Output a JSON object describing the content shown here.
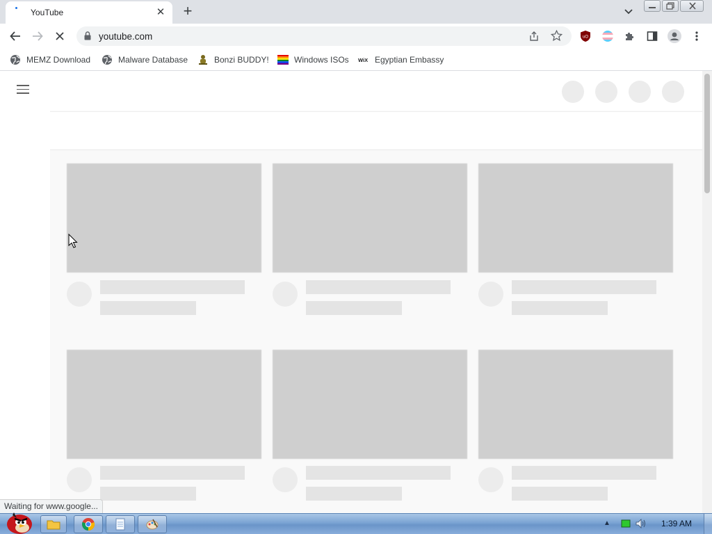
{
  "browser": {
    "tab": {
      "title": "YouTube"
    },
    "url": "youtube.com",
    "bookmarks": [
      {
        "label": "MEMZ Download",
        "icon": "globe-icon"
      },
      {
        "label": "Malware Database",
        "icon": "globe-icon"
      },
      {
        "label": "Bonzi BUDDY!",
        "icon": "bonzi-icon"
      },
      {
        "label": "Windows ISOs",
        "icon": "rainbow-icon"
      },
      {
        "label": "Egyptian Embassy",
        "icon": "wix-icon"
      }
    ],
    "status_text": "Waiting for www.google...",
    "extensions": [
      "ublock-origin-icon",
      "trans-flag-extension-icon",
      "extensions-puzzle-icon"
    ]
  },
  "youtube": {
    "state": "loading-skeleton",
    "header_placeholders": 4,
    "video_placeholders": 6
  },
  "taskbar": {
    "clock": "1:39 AM",
    "pinned": [
      "file-explorer-icon",
      "chrome-icon",
      "notepad-icon",
      "paint-icon"
    ]
  },
  "colors": {
    "skeleton_thumb": "#cfcfcf",
    "skeleton_line": "#e4e4e4",
    "page_bg": "#f9f9f9",
    "tabstrip_bg": "#dee1e6"
  }
}
